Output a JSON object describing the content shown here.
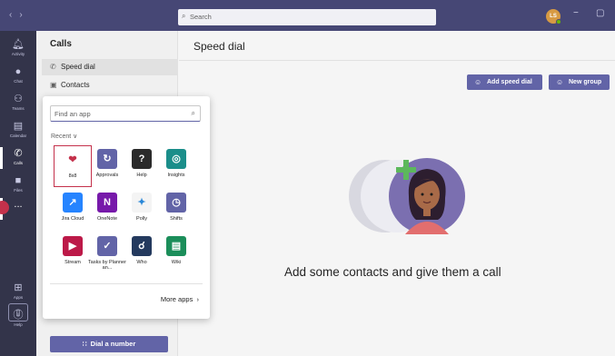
{
  "topbar": {
    "back_icon": "chevron-left-icon",
    "forward_icon": "chevron-right-icon",
    "search_placeholder": "Search",
    "avatar_initials": "LS",
    "minimize_glyph": "−",
    "maximize_glyph": "▢",
    "accent": "#464775"
  },
  "rail": {
    "items": [
      {
        "label": "Activity",
        "icon": "bell-icon"
      },
      {
        "label": "Chat",
        "icon": "chat-icon"
      },
      {
        "label": "Teams",
        "icon": "teams-icon"
      },
      {
        "label": "Calendar",
        "icon": "calendar-icon"
      },
      {
        "label": "Calls",
        "icon": "phone-icon"
      },
      {
        "label": "Files",
        "icon": "file-icon"
      },
      {
        "label": "...",
        "icon": "more-icon"
      },
      {
        "label": "Apps",
        "icon": "apps-icon"
      },
      {
        "label": "Help",
        "icon": "help-icon"
      }
    ]
  },
  "calls": {
    "title": "Calls",
    "items": [
      {
        "label": "Speed dial",
        "icon": "phone-icon"
      },
      {
        "label": "Contacts",
        "icon": "contacts-icon"
      }
    ],
    "dial_button": "Dial a number"
  },
  "main": {
    "title": "Speed dial",
    "add_speed_dial": "Add speed dial",
    "new_group": "New group",
    "empty_message": "Add some contacts and give them a call"
  },
  "flyout": {
    "search_placeholder": "Find an app",
    "recent_label": "Recent",
    "apps": [
      {
        "label": "8x8",
        "color": "#ffffff"
      },
      {
        "label": "Approvals",
        "color": "#6264a7"
      },
      {
        "label": "Help",
        "color": "#2b2b2b"
      },
      {
        "label": "Insights",
        "color": "#1b8e8a"
      },
      {
        "label": "Jira Cloud",
        "color": "#2684ff"
      },
      {
        "label": "OneNote",
        "color": "#7719aa"
      },
      {
        "label": "Polly",
        "color": "#f4f4f4"
      },
      {
        "label": "Shifts",
        "color": "#6264a7"
      },
      {
        "label": "Stream",
        "color": "#bc1948"
      },
      {
        "label": "Tasks by Planner an...",
        "color": "#6264a7"
      },
      {
        "label": "Who",
        "color": "#243a5e"
      },
      {
        "label": "Wiki",
        "color": "#1b8e5a"
      }
    ],
    "more_apps": "More apps"
  }
}
